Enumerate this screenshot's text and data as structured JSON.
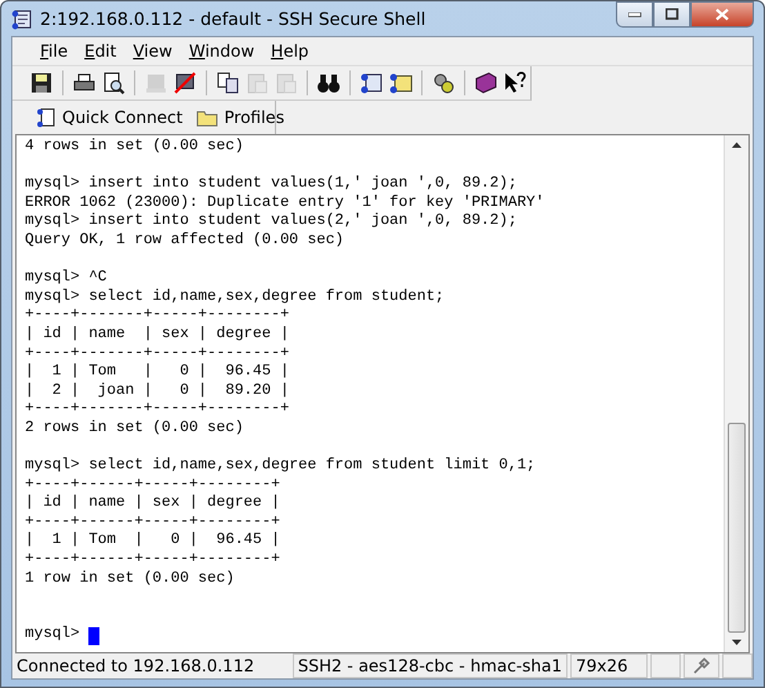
{
  "window": {
    "title": "2:192.168.0.112 - default - SSH Secure Shell"
  },
  "menu": [
    {
      "label": "File"
    },
    {
      "label": "Edit"
    },
    {
      "label": "View"
    },
    {
      "label": "Window"
    },
    {
      "label": "Help"
    }
  ],
  "toolbar": [
    [
      {
        "disabled": false
      }
    ],
    [
      {
        "disabled": false
      },
      {
        "disabled": false
      }
    ],
    [
      {
        "disabled": true
      },
      {
        "disabled": false
      }
    ],
    [
      {
        "disabled": false
      },
      {
        "disabled": true
      },
      {
        "disabled": true
      }
    ],
    [
      {
        "disabled": false
      }
    ],
    [
      {
        "disabled": false
      },
      {
        "disabled": false
      }
    ],
    [
      {
        "disabled": false
      }
    ],
    [
      {
        "disabled": false
      },
      {
        "disabled": false
      }
    ]
  ],
  "shortcuts": [
    {
      "label": "Quick Connect"
    },
    {
      "label": "Profiles"
    }
  ],
  "terminal": {
    "blocks": [
      [
        "4 rows in set (0.00 sec)"
      ],
      [
        "mysql> insert into student values(1,' joan ',0, 89.2);",
        "ERROR 1062 (23000): Duplicate entry '1' for key 'PRIMARY'",
        "mysql> insert into student values(2,' joan ',0, 89.2);",
        "Query OK, 1 row affected (0.00 sec)"
      ],
      [
        "mysql> ^C",
        "mysql> select id,name,sex,degree from student;",
        "+----+-------+-----+--------+",
        "| id | name  | sex | degree |",
        "+----+-------+-----+--------+",
        "|  1 | Tom   |   0 |  96.45 |",
        "|  2 |  joan |   0 |  89.20 |",
        "+----+-------+-----+--------+",
        "2 rows in set (0.00 sec)"
      ],
      [
        "mysql> select id,name,sex,degree from student limit 0,1;",
        "+----+------+-----+--------+",
        "| id | name | sex | degree |",
        "+----+------+-----+--------+",
        "|  1 | Tom  |   0 |  96.45 |",
        "+----+------+-----+--------+",
        "1 row in set (0.00 sec)"
      ]
    ],
    "prompt": "mysql>"
  },
  "status_bar": {
    "connection": "Connected to 192.168.0.112",
    "cipher": "SSH2 - aes128-cbc - hmac-sha1",
    "size": "79x26"
  }
}
